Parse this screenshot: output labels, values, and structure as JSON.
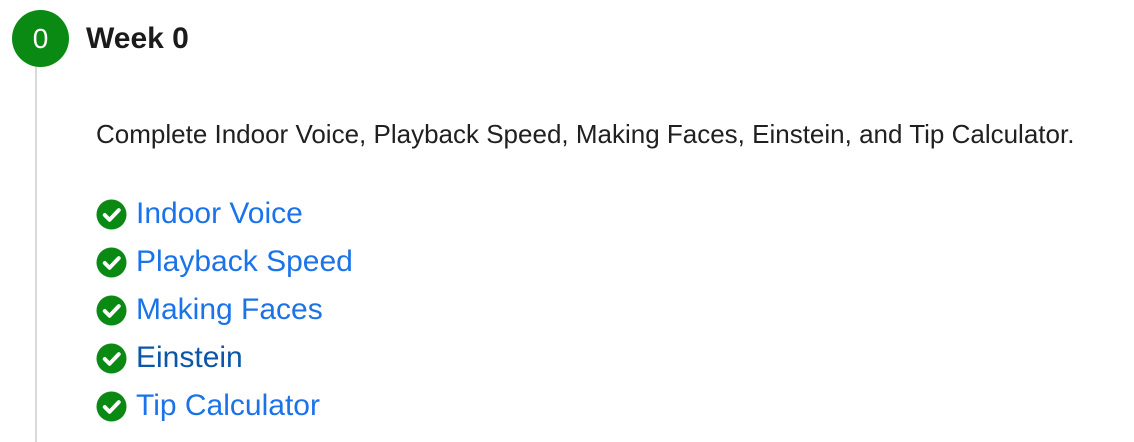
{
  "week": {
    "number": "0",
    "title": "Week 0",
    "description": "Complete Indoor Voice, Playback Speed, Making Faces, Einstein, and Tip Calculator.",
    "status_color": "#0a8a12",
    "check_icon": "check-circle-icon",
    "assignments": [
      {
        "label": "Indoor Voice",
        "link_color": "#1a73e8"
      },
      {
        "label": "Playback Speed",
        "link_color": "#1a73e8"
      },
      {
        "label": "Making Faces",
        "link_color": "#1a73e8"
      },
      {
        "label": "Einstein",
        "link_color": "#0b56a8"
      },
      {
        "label": "Tip Calculator",
        "link_color": "#1a73e8"
      }
    ]
  }
}
